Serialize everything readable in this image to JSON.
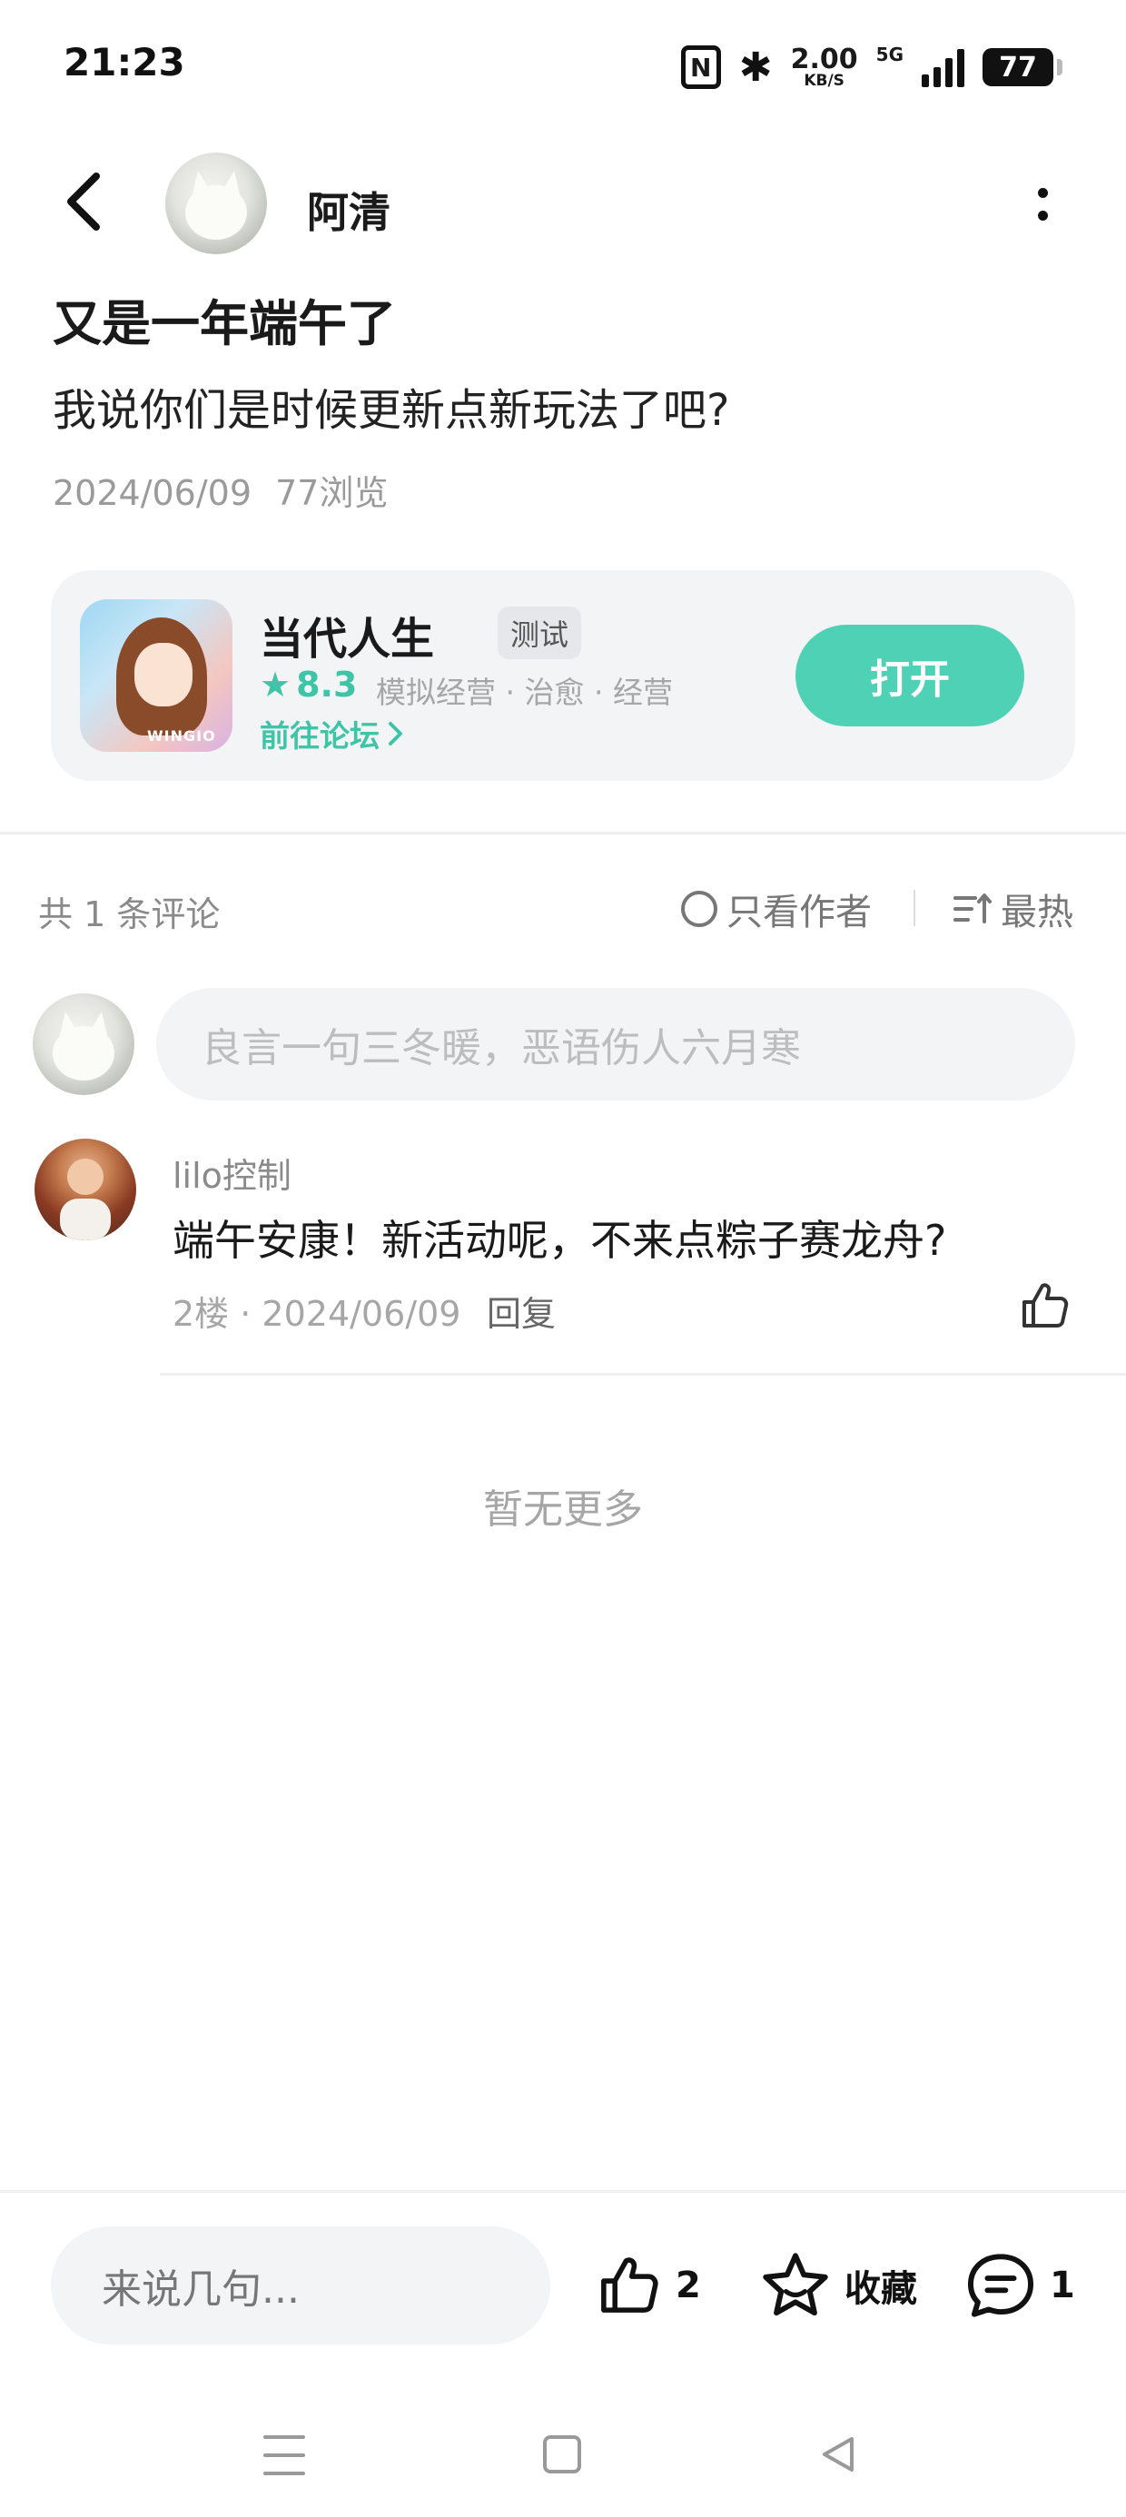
{
  "status_bar": {
    "time": "21:23",
    "nfc": "N",
    "speed_value": "2.00",
    "speed_unit": "KB/S",
    "network": "5G",
    "battery": "77"
  },
  "header": {
    "back_icon": "chevron-left-icon",
    "author_name": "阿清",
    "more_icon": "vertical-dots-icon"
  },
  "post": {
    "title": "又是一年端午了",
    "body": "我说你们是时候更新点新玩法了吧?",
    "date": "2024/06/09",
    "views": "77浏览"
  },
  "app_card": {
    "name": "当代人生",
    "badge": "测试",
    "icon_label": "WINGIO",
    "rating": "8.3",
    "tags": "模拟经营 · 治愈 · 经营",
    "forum_link": "前往论坛",
    "open_button": "打开",
    "accent_color": "#4fd1b5"
  },
  "comments_header": {
    "count": "共 1 条评论",
    "author_only": "只看作者",
    "sort": "最热"
  },
  "comment_input": {
    "placeholder": "良言一句三冬暖，恶语伤人六月寒"
  },
  "comments": [
    {
      "user": "lilo控制",
      "text": "端午安康！新活动呢，不来点粽子赛龙舟?",
      "meta": "2楼 · 2024/06/09",
      "reply": "回复"
    }
  ],
  "no_more": "暂无更多",
  "bottom_bar": {
    "input_placeholder": "来说几句...",
    "like_count": "2",
    "favorite_label": "收藏",
    "comment_count": "1"
  }
}
